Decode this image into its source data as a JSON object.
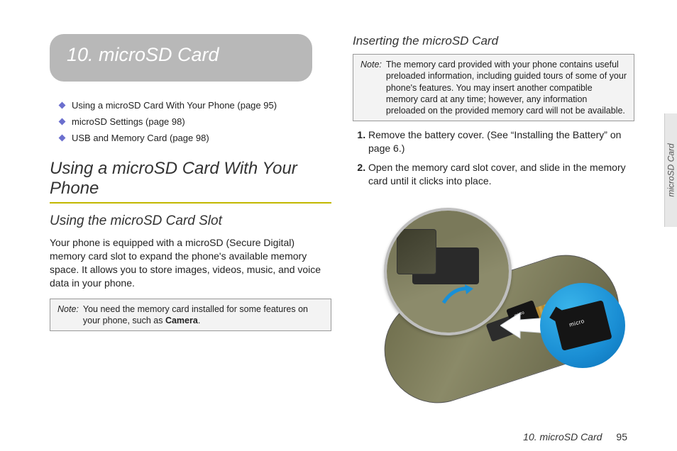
{
  "chapter": {
    "title": "10. microSD Card"
  },
  "toc": [
    {
      "label": "Using a microSD Card With Your Phone (page 95)"
    },
    {
      "label": "microSD Settings (page 98)"
    },
    {
      "label": "USB and Memory Card (page 98)"
    }
  ],
  "left": {
    "h2": "Using a microSD Card With Your Phone",
    "h3": "Using the microSD Card Slot",
    "body": "Your phone is equipped with a microSD (Secure Digital) memory card slot to expand the phone's available memory space. It allows you to store images, videos, music, and voice data in your phone.",
    "note": {
      "label": "Note:",
      "text_pre": "You need the memory card installed for some features on your phone, such as ",
      "bold": "Camera",
      "text_post": "."
    }
  },
  "right": {
    "h3": "Inserting the microSD Card",
    "note": {
      "label": "Note:",
      "text": "The memory card provided with your phone contains useful preloaded information, including guided tours of some of your phone's features. You may insert another compatible memory card at any time; however, any information preloaded on the provided memory card will not be available."
    },
    "steps": [
      "Remove the battery cover. (See “Installing the Battery” on page 6.)",
      "Open the memory card slot cover, and slide in the memory card until it clicks into place."
    ],
    "sd_label": "micro"
  },
  "side_tab": "microSD Card",
  "footer": {
    "chapter": "10. microSD Card",
    "page": "95"
  }
}
